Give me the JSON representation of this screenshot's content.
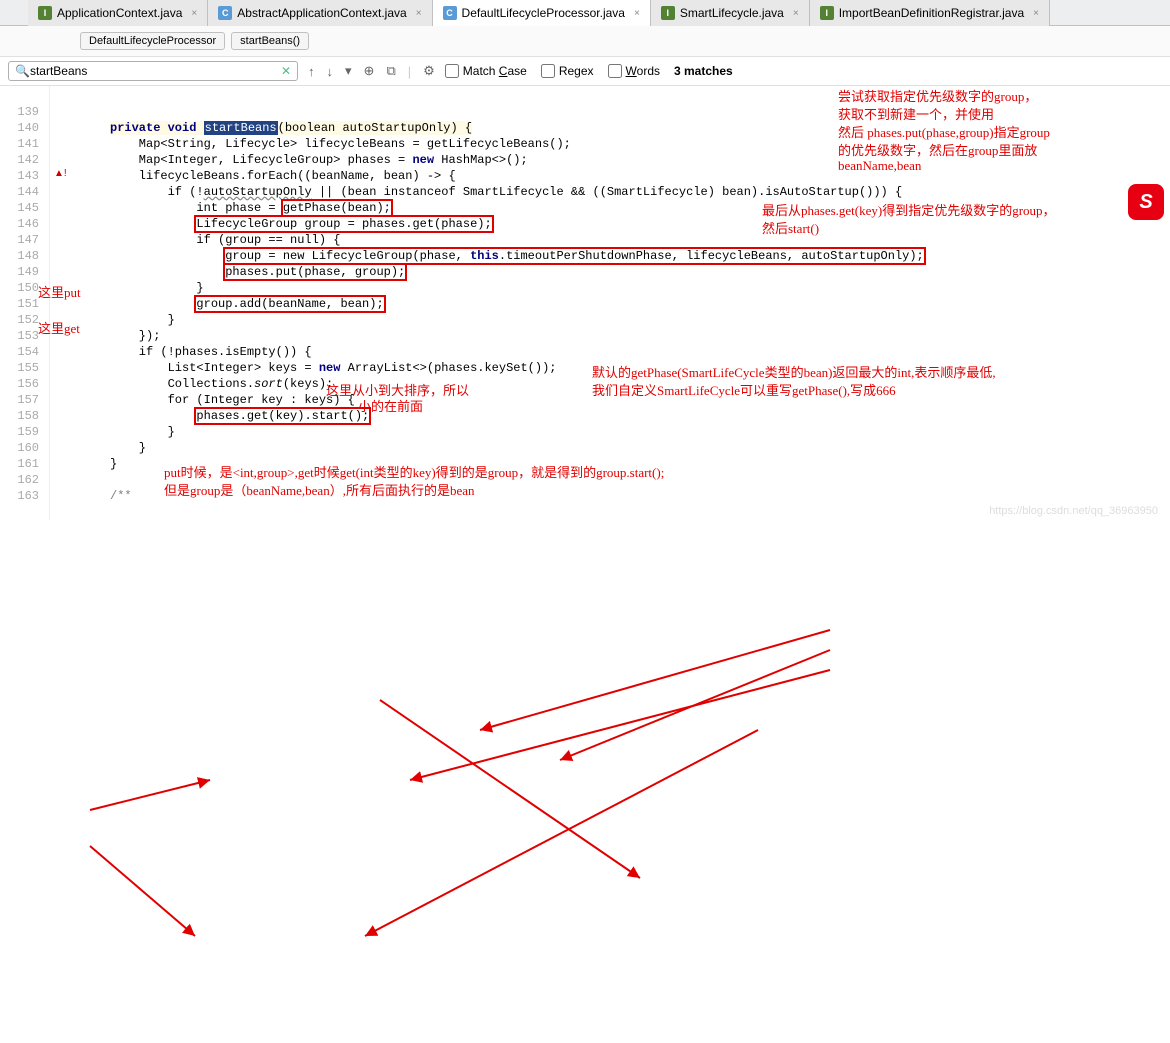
{
  "tabs": [
    {
      "label": "ApplicationContext.java",
      "icon": "I"
    },
    {
      "label": "AbstractApplicationContext.java",
      "icon": "C"
    },
    {
      "label": "DefaultLifecycleProcessor.java",
      "icon": "C",
      "active": true
    },
    {
      "label": "SmartLifecycle.java",
      "icon": "I"
    },
    {
      "label": "ImportBeanDefinitionRegistrar.java",
      "icon": "I"
    }
  ],
  "breadcrumbs": {
    "class": "DefaultLifecycleProcessor",
    "method": "startBeans()"
  },
  "search": {
    "value": "startBeans",
    "match_case": "Match Case",
    "regex": "Regex",
    "words": "Words",
    "matches": "3 matches"
  },
  "gutter": [
    "139",
    "140",
    "141",
    "142",
    "143",
    "144",
    "145",
    "146",
    "147",
    "148",
    "149",
    "150",
    "151",
    "152",
    "153",
    "154",
    "155",
    "156",
    "157",
    "158",
    "159",
    "160",
    "161",
    "162",
    "163"
  ],
  "code": {
    "l140a": "private void ",
    "l140b": "startBeans",
    "l140c": "(boolean autoStartupOnly) {",
    "l141": "    Map<String, Lifecycle> lifecycleBeans = getLifecycleBeans();",
    "l142a": "    Map<Integer, LifecycleGroup> phases = ",
    "l142b": "new",
    "l142c": " HashMap<>();",
    "l143": "    lifecycleBeans.forEach((beanName, bean) -> {",
    "l144a": "        if (!",
    "l144u": "autoStartupOnly",
    "l144b": " || (bean instanceof SmartLifecycle && ((SmartLifecycle) bean).isAutoStartup())) {",
    "l145a": "            int phase = ",
    "l145box": "getPhase(bean);",
    "l146box": "LifecycleGroup group = phases.get(phase);",
    "l147": "            if (group == null) {",
    "l148a_box": "group = new LifecycleGroup(phase, ",
    "l148b": "this",
    "l148c": ".timeoutPerShutdownPhase, lifecycleBeans, autoStartupOnly);",
    "l149box": "phases.put(phase, group);",
    "l150": "            }",
    "l151box": "group.add(beanName, bean);",
    "l152": "        }",
    "l153": "    });",
    "l154": "    if (!phases.isEmpty()) {",
    "l155a": "        List<Integer> keys = ",
    "l155b": "new",
    "l155c": " ArrayList<>(phases.keySet());",
    "l156a": "        Collections.",
    "l156i": "sort",
    "l156b": "(keys);",
    "l157": "        for (Integer key : keys) {",
    "l158box": "phases.get(key).start();",
    "l159": "        }",
    "l160": "    }",
    "l161": "}",
    "l163": "/**"
  },
  "annotations": {
    "top1": "尝试获取指定优先级数字的group，",
    "top2": "获取不到新建一个，并使用",
    "top3": "然后 phases.put(phase,group)指定group",
    "top4": "的优先级数字，然后在group里面放",
    "top5": "beanName,bean",
    "right1": "最后从phases.get(key)得到指定优先级数字的group，",
    "right2": "然后start()",
    "leftput": "这里put",
    "leftget": "这里get",
    "sort1": "这里从小到大排序，所以",
    "sort2": "小的在前面",
    "mid1": "默认的getPhase(SmartLifeCycle类型的bean)返回最大的int,表示顺序最低,",
    "mid2": "我们自定义SmartLifeCycle可以重写getPhase(),写成666",
    "bot1": "put时候，是<int,group>,get时候get(int类型的key)得到的是group，就是得到的group.start();",
    "bot2": "但是group是（beanName,bean）,所有后面执行的是bean"
  },
  "watermark": "https://blog.csdn.net/qq_36963950",
  "logo": "S"
}
